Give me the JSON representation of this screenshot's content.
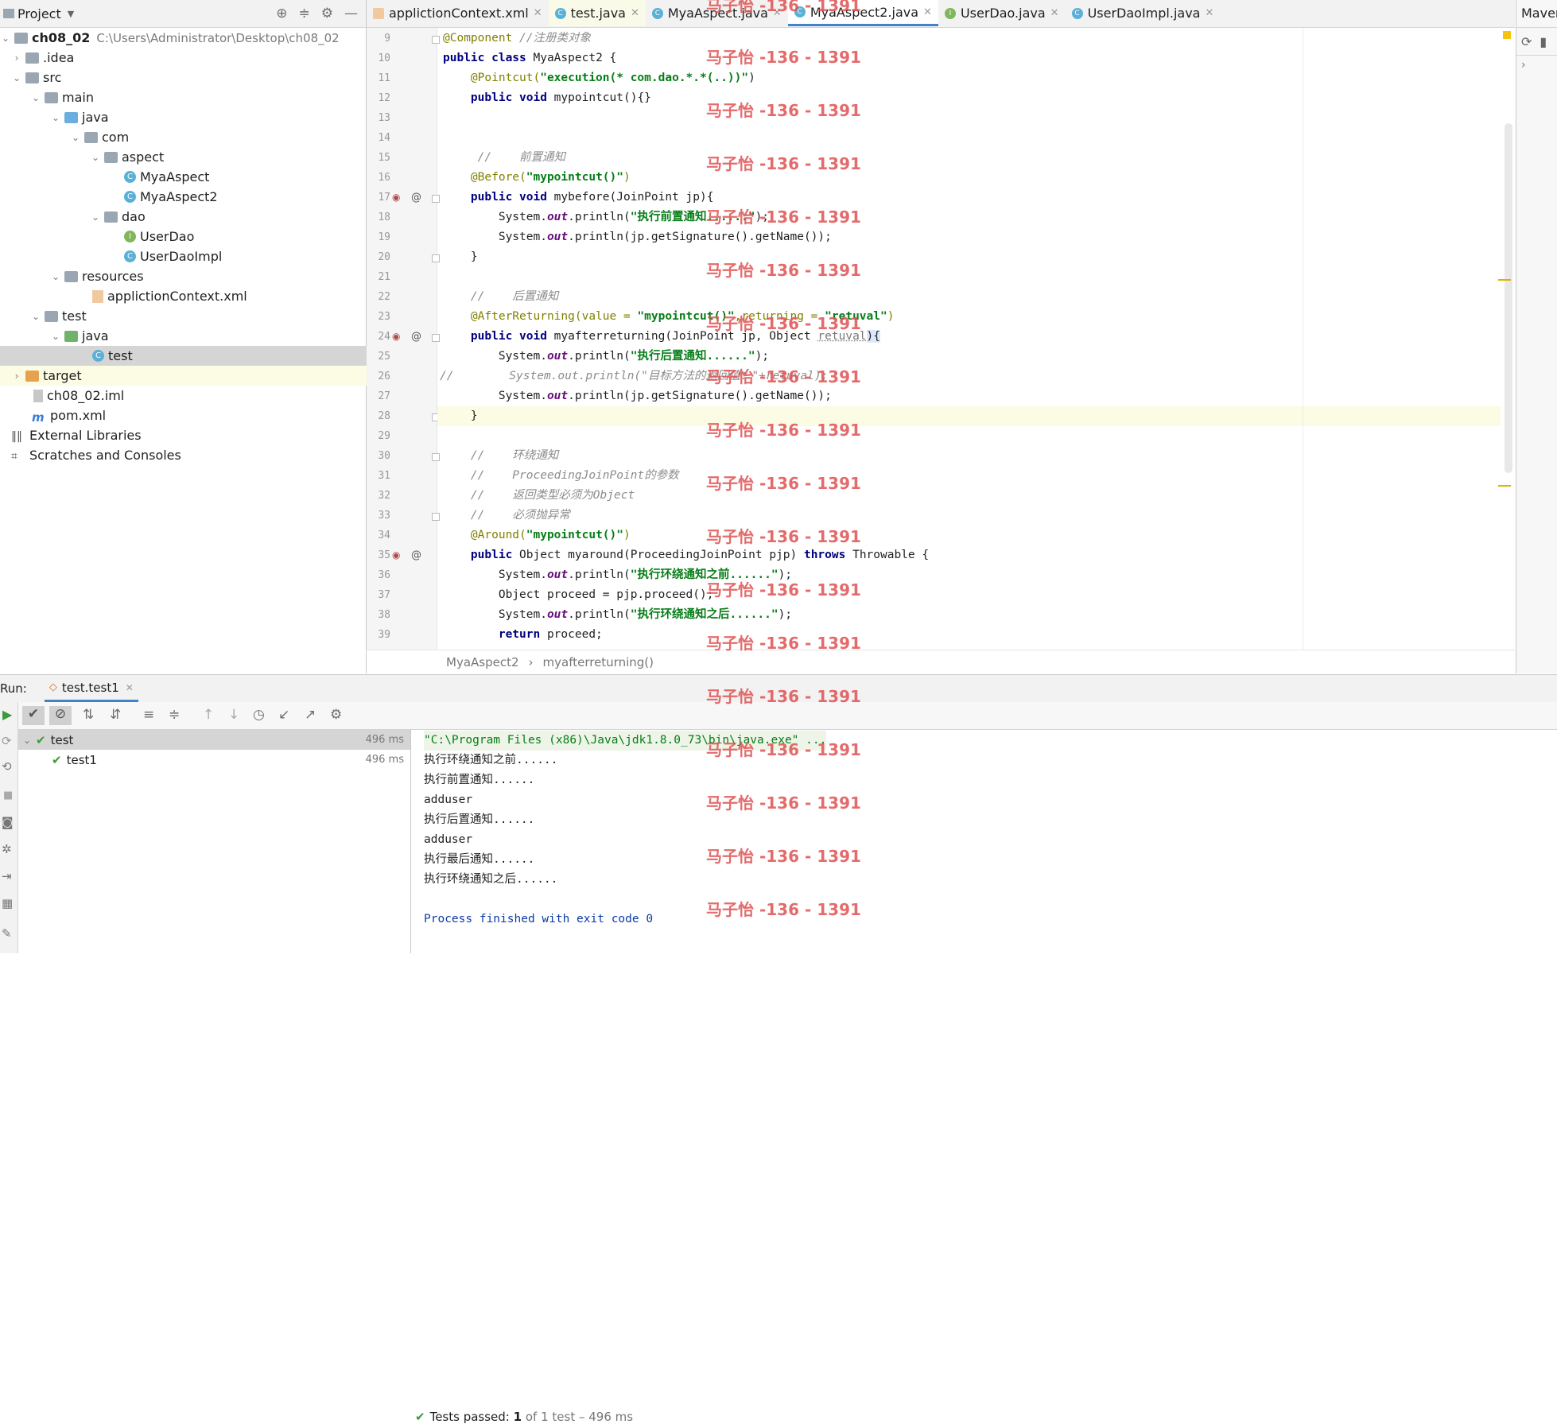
{
  "project_panel": {
    "title": "Project",
    "tree": [
      {
        "label": "ch08_02",
        "extra": "C:\\Users\\Administrator\\Desktop\\ch08_02"
      },
      {
        "label": ".idea"
      },
      {
        "label": "src"
      },
      {
        "label": "main"
      },
      {
        "label": "java"
      },
      {
        "label": "com"
      },
      {
        "label": "aspect"
      },
      {
        "label": "MyaAspect"
      },
      {
        "label": "MyaAspect2"
      },
      {
        "label": "dao"
      },
      {
        "label": "UserDao"
      },
      {
        "label": "UserDaoImpl"
      },
      {
        "label": "resources"
      },
      {
        "label": "applictionContext.xml"
      },
      {
        "label": "test"
      },
      {
        "label": "java"
      },
      {
        "label": "test"
      },
      {
        "label": "target"
      },
      {
        "label": "ch08_02.iml"
      },
      {
        "label": "pom.xml"
      },
      {
        "label": "External Libraries"
      },
      {
        "label": "Scratches and Consoles"
      }
    ]
  },
  "tabs": [
    {
      "label": "applictionContext.xml"
    },
    {
      "label": "test.java"
    },
    {
      "label": "MyaAspect.java"
    },
    {
      "label": "MyaAspect2.java"
    },
    {
      "label": "UserDao.java"
    },
    {
      "label": "UserDaoImpl.java"
    }
  ],
  "maven_label": "Maver",
  "editor": {
    "line_numbers": [
      "9",
      "10",
      "11",
      "12",
      "13",
      "14",
      "15",
      "16",
      "17",
      "18",
      "19",
      "20",
      "21",
      "22",
      "23",
      "24",
      "25",
      "26",
      "27",
      "28",
      "29",
      "30",
      "31",
      "32",
      "33",
      "34",
      "35",
      "36",
      "37",
      "38",
      "39"
    ],
    "lines": {
      "l9_a": "@Component",
      "l9_b": " //注册类对象",
      "l10_a": "public class",
      "l10_b": " MyaAspect2 {",
      "l11_a": "    @Pointcut(",
      "l11_b": "\"execution(* com.dao.*.*(..))\"",
      "l11_c": ")",
      "l12_a": "    public void",
      "l12_b": " mypointcut(){}",
      "l15": "     //    前置通知",
      "l16_a": "    @Before(",
      "l16_b": "\"mypointcut()\"",
      "l16_c": ")",
      "l17_a": "    public void",
      "l17_b": " mybefore(JoinPoint jp){",
      "l18_a": "        System.",
      "l18_b": "out",
      "l18_c": ".println(",
      "l18_d": "\"执行前置通知......\"",
      "l18_e": ");",
      "l19_a": "        System.",
      "l19_b": "out",
      "l19_c": ".println(jp.getSignature().getName());",
      "l20": "    }",
      "l22": "    //    后置通知",
      "l23_a": "    @AfterReturning(value = ",
      "l23_b": "\"mypointcut()\"",
      "l23_c": ",returning = ",
      "l23_d": "\"retuval\"",
      "l23_e": ")",
      "l24_a": "    public void",
      "l24_b": " myafterreturning(JoinPoint jp, Object ",
      "l24_c": "retuval",
      "l24_d": "){",
      "l25_a": "        System.",
      "l25_b": "out",
      "l25_c": ".println(",
      "l25_d": "\"执行后置通知......\"",
      "l25_e": ");",
      "l26": "//        System.out.println(\"目标方法的返回值：\"+retuval);",
      "l27_a": "        System.",
      "l27_b": "out",
      "l27_c": ".println(jp.getSignature().getName());",
      "l28": "    }",
      "l30": "    //    环绕通知",
      "l31": "    //    ProceedingJoinPoint的参数",
      "l32": "    //    返回类型必须为Object",
      "l33": "    //    必须抛异常",
      "l34_a": "    @Around(",
      "l34_b": "\"mypointcut()\"",
      "l34_c": ")",
      "l35_a": "    public",
      "l35_b": " Object myaround(ProceedingJoinPoint pjp) ",
      "l35_c": "throws",
      "l35_d": " Throwable {",
      "l36_a": "        System.",
      "l36_b": "out",
      "l36_c": ".println(",
      "l36_d": "\"执行环绕通知之前......\"",
      "l36_e": ");",
      "l37": "        Object proceed = pjp.proceed();",
      "l38_a": "        System.",
      "l38_b": "out",
      "l38_c": ".println(",
      "l38_d": "\"执行环绕通知之后......\"",
      "l38_e": ");",
      "l39_a": "        return",
      "l39_b": " proceed;"
    }
  },
  "breadcrumb": {
    "class": "MyaAspect2",
    "sep": "›",
    "method": "myafterreturning()"
  },
  "watermark": "马子怡 -136 - 1391",
  "run": {
    "label": "Run:",
    "tab": "test.test1",
    "status_prefix": "Tests passed:",
    "status_count": "1",
    "status_suffix": "of 1 test – 496 ms",
    "tree": [
      {
        "label": "test",
        "duration": "496 ms"
      },
      {
        "label": "test1",
        "duration": "496 ms"
      }
    ],
    "console": [
      "\"C:\\Program Files (x86)\\Java\\jdk1.8.0_73\\bin\\java.exe\" ...",
      "执行环绕通知之前......",
      "执行前置通知......",
      "adduser",
      "执行后置通知......",
      "adduser",
      "执行最后通知......",
      "执行环绕通知之后......",
      "",
      "Process finished with exit code 0"
    ]
  }
}
